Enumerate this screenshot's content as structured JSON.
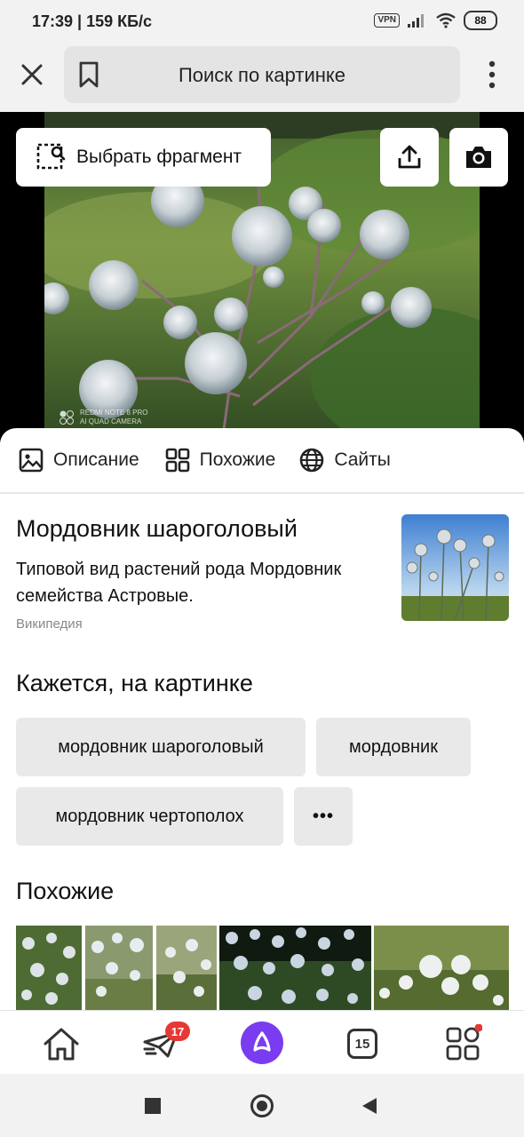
{
  "status_bar": {
    "time_speed": "17:39 | 159 КБ/с",
    "vpn": "VPN",
    "battery": "88"
  },
  "toolbar": {
    "title": "Поиск по картинке",
    "close_icon": "close-icon",
    "bookmark_icon": "bookmark-icon",
    "menu_icon": "more-vert-icon"
  },
  "image_overlay": {
    "fragment_label": "Выбрать фрагмент",
    "watermark_line1": "REDMI NOTE 8 PRO",
    "watermark_line2": "AI QUAD CAMERA"
  },
  "tabs": [
    {
      "label": "Описание",
      "icon": "image-icon"
    },
    {
      "label": "Похожие",
      "icon": "grid-icon"
    },
    {
      "label": "Сайты",
      "icon": "globe-icon"
    }
  ],
  "result": {
    "title": "Мордовник шароголовый",
    "description": "Типовой вид растений рода Мордовник семейства Астровые.",
    "source": "Википедия"
  },
  "seems": {
    "title": "Кажется, на картинке",
    "chips": [
      "мордовник шароголовый",
      "мордовник",
      "мордовник чертополох"
    ],
    "more_label": "•••"
  },
  "similar": {
    "title": "Похожие"
  },
  "bottom_nav": {
    "messages_badge": "17",
    "tabs_count": "15"
  },
  "colors": {
    "accent_alice": "#7a3cf0",
    "badge_red": "#e53935",
    "chip_bg": "#e9e9e9"
  }
}
